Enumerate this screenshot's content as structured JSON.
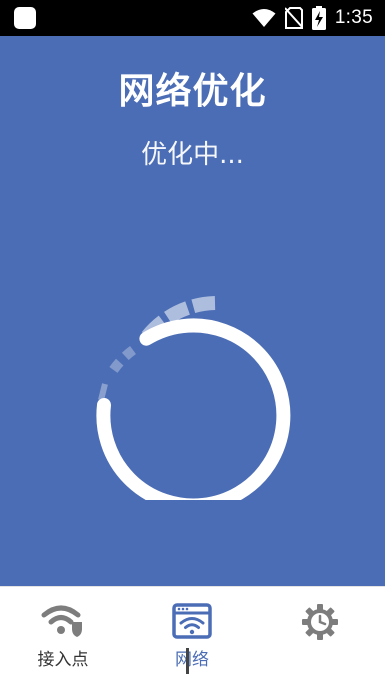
{
  "status_bar": {
    "time": "1:35",
    "icons": [
      "app-icon",
      "wifi-icon",
      "no-sim-icon",
      "battery-charging-icon"
    ]
  },
  "header": {
    "title": "网络优化",
    "status": "优化中..."
  },
  "bottom_nav": {
    "items": [
      {
        "label": "接入点",
        "icon": "wifi-shield-icon",
        "active": false
      },
      {
        "label": "网络",
        "icon": "browser-wifi-icon",
        "active": true
      },
      {
        "label": "",
        "icon": "gear-clock-icon",
        "active": false
      }
    ]
  },
  "colors": {
    "primary": "#4b6db5",
    "status_bar": "#000000",
    "nav_icon": "#7d7d7d",
    "nav_active": "#4b6db5"
  }
}
